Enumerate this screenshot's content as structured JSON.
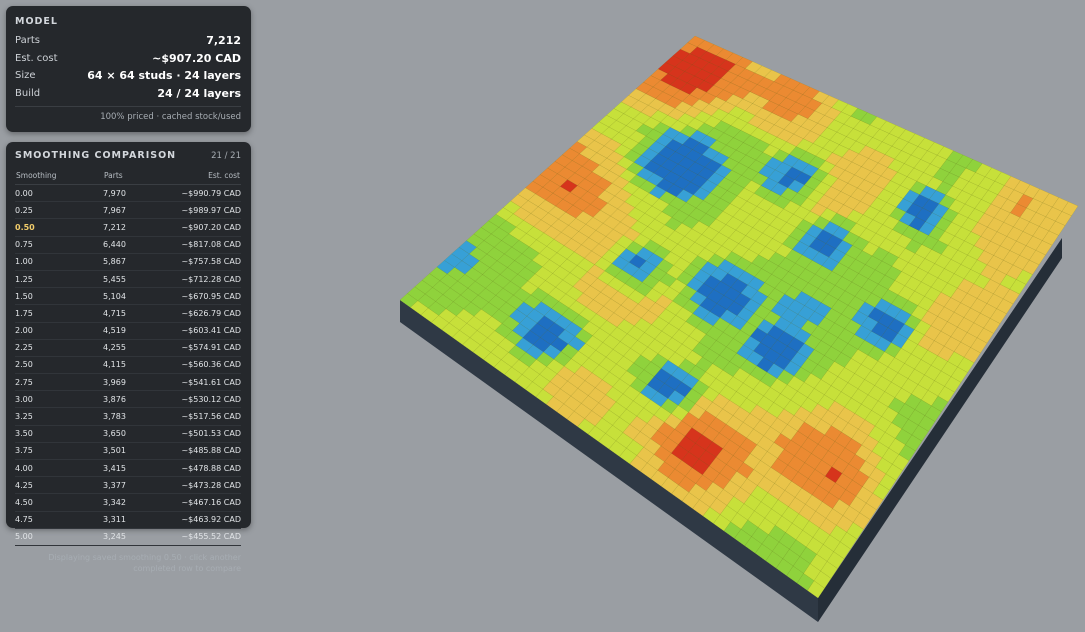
{
  "model": {
    "title": "MODEL",
    "rows": [
      {
        "label": "Parts",
        "value": "7,212"
      },
      {
        "label": "Est. cost",
        "value": "~$907.20 CAD"
      },
      {
        "label": "Size",
        "value": "64 × 64 studs · 24 layers"
      },
      {
        "label": "Build",
        "value": "24 / 24 layers"
      }
    ],
    "note": "100% priced · cached stock/used"
  },
  "comparison": {
    "title": "SMOOTHING COMPARISON",
    "count": "21 / 21",
    "columns": [
      "Smoothing",
      "Parts",
      "Est. cost"
    ],
    "selected_index": 2,
    "rows": [
      [
        "0.00",
        "7,970",
        "~$990.79 CAD"
      ],
      [
        "0.25",
        "7,967",
        "~$989.97 CAD"
      ],
      [
        "0.50",
        "7,212",
        "~$907.20 CAD"
      ],
      [
        "0.75",
        "6,440",
        "~$817.08 CAD"
      ],
      [
        "1.00",
        "5,867",
        "~$757.58 CAD"
      ],
      [
        "1.25",
        "5,455",
        "~$712.28 CAD"
      ],
      [
        "1.50",
        "5,104",
        "~$670.95 CAD"
      ],
      [
        "1.75",
        "4,715",
        "~$626.79 CAD"
      ],
      [
        "2.00",
        "4,519",
        "~$603.41 CAD"
      ],
      [
        "2.25",
        "4,255",
        "~$574.91 CAD"
      ],
      [
        "2.50",
        "4,115",
        "~$560.36 CAD"
      ],
      [
        "2.75",
        "3,969",
        "~$541.61 CAD"
      ],
      [
        "3.00",
        "3,876",
        "~$530.12 CAD"
      ],
      [
        "3.25",
        "3,783",
        "~$517.56 CAD"
      ],
      [
        "3.50",
        "3,650",
        "~$501.53 CAD"
      ],
      [
        "3.75",
        "3,501",
        "~$485.88 CAD"
      ],
      [
        "4.00",
        "3,415",
        "~$478.88 CAD"
      ],
      [
        "4.25",
        "3,377",
        "~$473.28 CAD"
      ],
      [
        "4.50",
        "3,342",
        "~$467.16 CAD"
      ],
      [
        "4.75",
        "3,311",
        "~$463.92 CAD"
      ],
      [
        "5.00",
        "3,245",
        "~$455.52 CAD"
      ]
    ],
    "footer": "Displaying saved smoothing 0.50 · click another completed row to compare"
  },
  "colors": {
    "background": "#9a9ea3",
    "panel": "#25282c",
    "selected_row": "#f2cd6b",
    "terrain": [
      "#1e6fc2",
      "#37a0d6",
      "#8fd23c",
      "#c7e03a",
      "#e9c44a",
      "#eb8a32",
      "#d6341c"
    ]
  }
}
